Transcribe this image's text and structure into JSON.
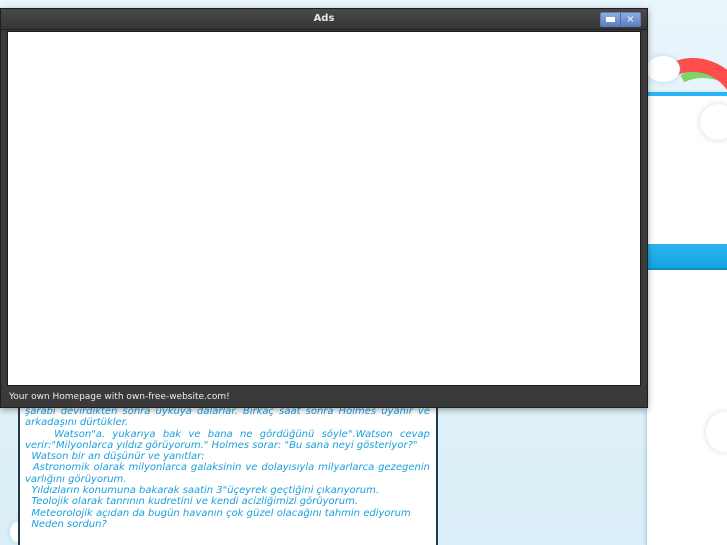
{
  "window": {
    "title": "Ads",
    "status_text": "Your own Homepage with own-free-website.com!",
    "controls": {
      "minimize_icon": "minimize-icon",
      "close_icon": "close-icon",
      "close_glyph": "×"
    }
  },
  "background_page": {
    "article_lines": [
      "şarabı devirdikten sonra uykuya dalarlar. Birkaç saat sonra Holmes uyanır ve arkadaşını dürtükler.",
      "    Watson\"a. yukarıya bak ve bana ne gördüğünü söyle\".Watson cevap verir:\"Milyonlarca yıldız görüyorum.\" Holmes sorar: \"Bu sana neyi gösteriyor?\"",
      "  Watson bir an düşünür ve yanıtlar:",
      "  Astronomik olarak milyonlarca galaksinin ve dolayısıyla milyarlarca gezegenin varlığını görüyorum.",
      "  Yıldızların konumuna bakarak saatin 3\"üçeyrek geçtiğini çıkarıyorum.",
      "  Teolojik olarak tanrının kudretini ve kendi acizliğimizi görüyorum.",
      "  Meteorolojik açıdan da bugün havanın çok güzel olacağını tahmin ediyorum",
      "  Neden sordun?"
    ]
  },
  "colors": {
    "article_text": "#1aa0dd",
    "accent_blue": "#29b6f6",
    "window_chrome": "#3a3a3a"
  }
}
